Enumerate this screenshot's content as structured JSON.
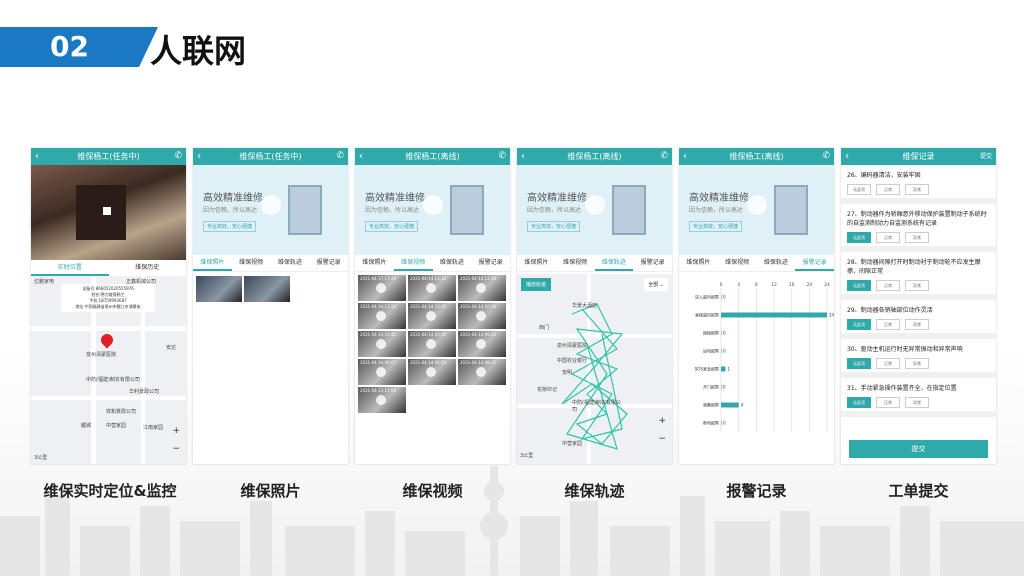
{
  "slide": {
    "number": "02",
    "title": "人联网"
  },
  "phones": [
    {
      "title": "维保杨工(任务中)",
      "tabs": [
        "实时位置",
        "维保历史"
      ],
      "active": 0,
      "info": [
        "设备号:866652020555976",
        "姓名:德力维保杨工",
        "手机:18759993687",
        "地址:中国福建省泉州市鲤江市浦景街"
      ],
      "map_labels": [
        "亿鹏家电",
        "正鑫机械公司",
        "泉州清蒙医院",
        "中防(福建)制衣有限公司",
        "华利景政公司",
        "祥和景政公司",
        "安达",
        "江南家园",
        "中营家园",
        "鲤城",
        "3公里"
      ]
    },
    {
      "title": "维保杨工(任务中)",
      "banner": {
        "t1": "高效精准维修",
        "t2": "因为信赖，所以高达",
        "t3": "专业高效，安心便捷"
      },
      "tabs": [
        "维保照片",
        "维保视频",
        "维保轨迹",
        "报警记录"
      ],
      "active": 0
    },
    {
      "title": "维保杨工(离线)",
      "banner": {
        "t1": "高效精准维修",
        "t2": "因为信赖，所以高达",
        "t3": "专业高效，安心便捷"
      },
      "tabs": [
        "维保照片",
        "维保视频",
        "维保轨迹",
        "报警记录"
      ],
      "active": 1,
      "video_dates": [
        "2021-04-17 17:26",
        "2021-04-14 13:18",
        "2021-04-14 12:30",
        "2021-04-14 11:50",
        "2021-04-14 10:35",
        "2021-04-14 10:40",
        "2021-04-14 10:45",
        "2021-04-14 10:30",
        "2021-04-14 09:26",
        "2021-04-14 09:07",
        "2021-04-14 08:50",
        "2021-04-14 08:35",
        "2021-04-13 17:09"
      ]
    },
    {
      "title": "维保杨工(离线)",
      "banner": {
        "t1": "高效精准维修",
        "t2": "因为信赖，所以高达",
        "t3": "专业高效，安心便捷"
      },
      "tabs": [
        "维保照片",
        "维保视频",
        "维保轨迹",
        "报警记录"
      ],
      "active": 2,
      "replay": "播放轨迹",
      "range": "全部",
      "map_labels": [
        "华景大酒店",
        "西门",
        "泉州清蒙医院",
        "中国农业银行",
        "安明",
        "花桥印记",
        "中防(福建)制衣有限公司",
        "中营家园",
        "3公里"
      ]
    },
    {
      "title": "维保杨工(离线)",
      "banner": {
        "t1": "高效精准维修",
        "t2": "因为信赖，所以高达",
        "t3": "专业高效，安心便捷"
      },
      "tabs": [
        "维保照片",
        "维保视频",
        "维保轨迹",
        "报警记录"
      ],
      "active": 3
    },
    {
      "title": "维保记录",
      "right": "提交",
      "items": [
        {
          "text": "26、编码器清洁，安装牢固",
          "sel": null
        },
        {
          "text": "27、制动器作为轿厢意外移动保护装置制动子系统时的自监测制动力自监测系统有记录",
          "sel": 0
        },
        {
          "text": "28、制动器间隙打开时制动衬于制动轮不应发生摩擦，间隙正常",
          "sel": 0
        },
        {
          "text": "29、制动器各销轴部位动作灵活",
          "sel": 0
        },
        {
          "text": "30、驱动主机运行时无异常振动和异常声响",
          "sel": 0
        },
        {
          "text": "31、手动紧急操作装置齐全，在指定位置",
          "sel": 0
        }
      ],
      "btn_labels": [
        "无此项",
        "正常",
        "异常"
      ],
      "submit": "提交"
    }
  ],
  "chart_data": {
    "type": "bar",
    "orientation": "horizontal",
    "categories": [
      "进入超时报警",
      "乘梯超时报警",
      "困梯报警",
      "运电报警",
      "SOS紧急报警",
      "开门报警",
      "频繁报警",
      "断电报警"
    ],
    "values": [
      0,
      24,
      0,
      0,
      1,
      0,
      4,
      0
    ],
    "x_ticks": [
      0,
      4,
      8,
      12,
      16,
      20,
      24
    ],
    "xlim": [
      0,
      24
    ],
    "color": "#2fa9a9"
  },
  "captions": [
    "维保实时定位&监控",
    "维保照片",
    "维保视频",
    "维保轨迹",
    "报警记录",
    "工单提交"
  ]
}
